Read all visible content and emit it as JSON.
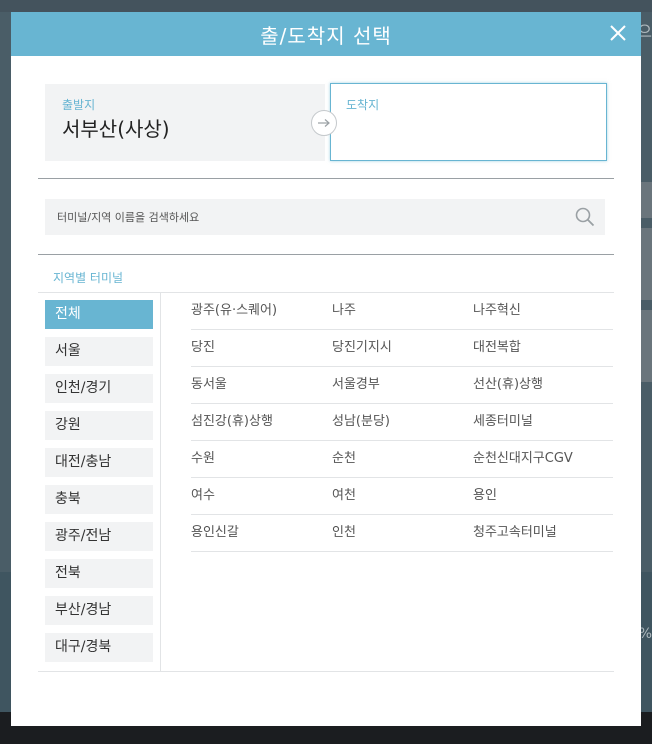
{
  "modal": {
    "title": "출/도착지 선택"
  },
  "route": {
    "departure_label": "출발지",
    "departure_value": "서부산(사상)",
    "arrival_label": "도착지",
    "arrival_value": ""
  },
  "search": {
    "placeholder": "터미널/지역 이름을 검색하세요"
  },
  "region_title": "지역별 터미널",
  "categories": [
    {
      "label": "전체",
      "active": true
    },
    {
      "label": "서울"
    },
    {
      "label": "인천/경기"
    },
    {
      "label": "강원"
    },
    {
      "label": "대전/충남"
    },
    {
      "label": "충북"
    },
    {
      "label": "광주/전남"
    },
    {
      "label": "전북"
    },
    {
      "label": "부산/경남"
    },
    {
      "label": "대구/경북"
    }
  ],
  "terminals": [
    [
      "광주(유·스퀘어)",
      "나주",
      "나주혁신"
    ],
    [
      "당진",
      "당진기지시",
      "대전복합"
    ],
    [
      "동서울",
      "서울경부",
      "선산(휴)상행"
    ],
    [
      "섬진강(휴)상행",
      "성남(분당)",
      "세종터미널"
    ],
    [
      "수원",
      "순천",
      "순천신대지구CGV"
    ],
    [
      "여수",
      "여천",
      "용인"
    ],
    [
      "용인신갈",
      "인천",
      "청주고속터미널"
    ]
  ],
  "colors": {
    "accent": "#68b5d2",
    "panel": "#f2f3f4"
  },
  "background": {
    "side_text_1": "으",
    "side_text_2": "%"
  }
}
